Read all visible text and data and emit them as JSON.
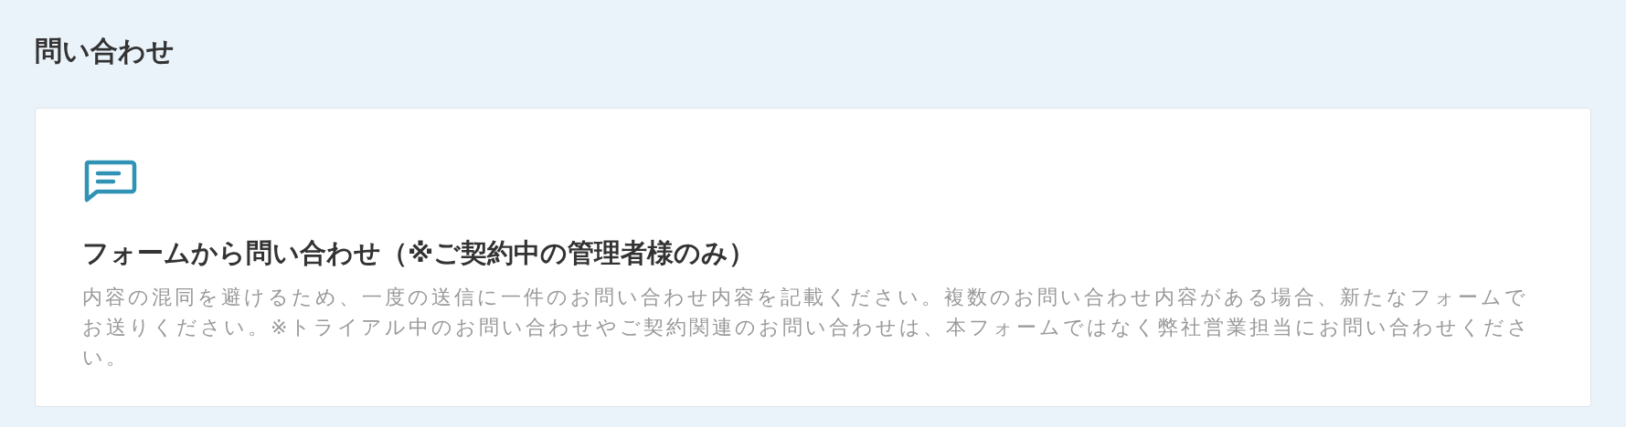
{
  "page": {
    "title": "問い合わせ"
  },
  "card": {
    "heading": "フォームから問い合わせ（※ご契約中の管理者様のみ）",
    "description": "内容の混同を避けるため、一度の送信に一件のお問い合わせ内容を記載ください。複数のお問い合わせ内容がある場合、新たなフォームでお送りください。※トライアル中のお問い合わせやご契約関連のお問い合わせは、本フォームではなく弊社営業担当にお問い合わせください。"
  }
}
